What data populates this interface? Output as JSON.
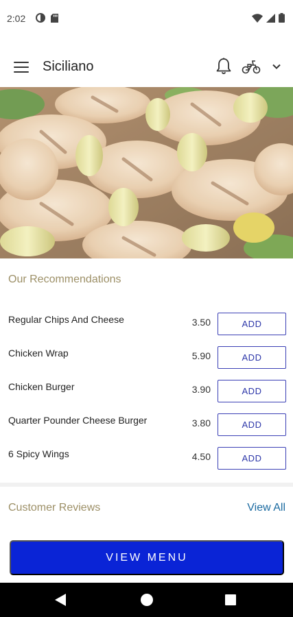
{
  "status_bar": {
    "time": "2:02"
  },
  "header": {
    "title": "Siciliano",
    "icons": [
      "menu-icon",
      "bell-icon",
      "scooter-icon",
      "chevron-down-icon"
    ]
  },
  "hero": {
    "image_subject": "grilled-chicken-skewers-image"
  },
  "recommendations": {
    "title": "Our Recommendations",
    "items": [
      {
        "name": "Regular Chips And Cheese",
        "price": "3.50",
        "action": "ADD"
      },
      {
        "name": "Chicken Wrap",
        "price": "5.90",
        "action": "ADD"
      },
      {
        "name": "Chicken Burger",
        "price": "3.90",
        "action": "ADD"
      },
      {
        "name": "Quarter Pounder Cheese Burger",
        "price": "3.80",
        "action": "ADD"
      },
      {
        "name": "6 Spicy Wings",
        "price": "4.50",
        "action": "ADD"
      }
    ]
  },
  "reviews": {
    "title": "Customer Reviews",
    "view_all": "View All"
  },
  "cta": {
    "view_menu": "VIEW MENU"
  },
  "colors": {
    "accent_gold": "#9c8f66",
    "primary_blue": "#0a24d6",
    "link_blue": "#1a6aa0",
    "add_border": "#3a3fb5"
  }
}
